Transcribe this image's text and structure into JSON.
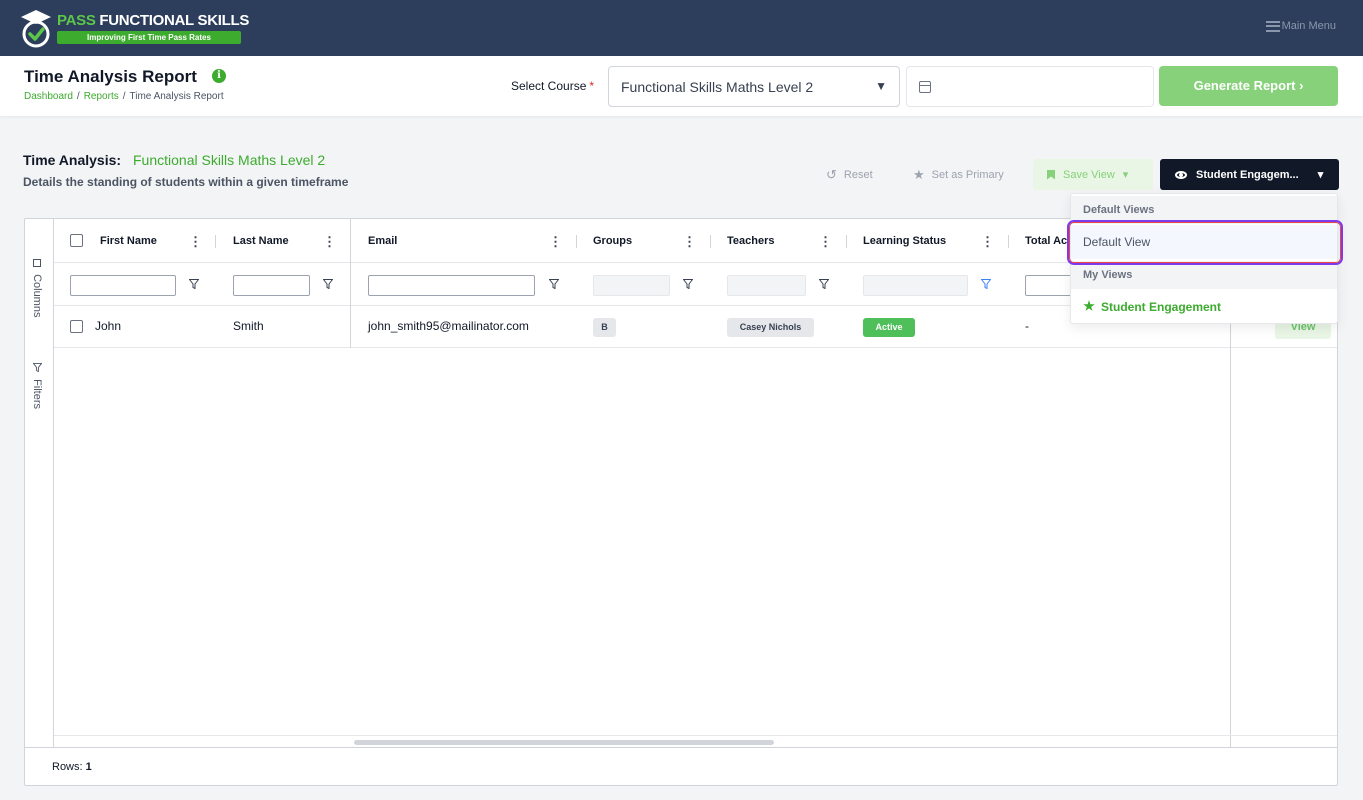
{
  "brand": {
    "title_accent": "PASS",
    "title_rest": " FUNCTIONAL SKILLS",
    "tagline": "Improving First Time Pass Rates"
  },
  "nav": {
    "main_menu": "Main Menu"
  },
  "header": {
    "title": "Time Analysis Report",
    "info_glyph": "i",
    "breadcrumb": [
      "Dashboard",
      "Reports",
      "Time Analysis Report"
    ],
    "breadcrumb_sep": "/",
    "select_label": "Select Course",
    "required_mark": "*",
    "course_value": "Functional Skills Maths Level 2",
    "caret": "▼",
    "date_value": "",
    "generate_label": "Generate Report ›"
  },
  "section": {
    "label": "Time Analysis:",
    "course": "Functional Skills Maths Level 2",
    "description": "Details the standing of students within a given timeframe"
  },
  "toolbar": {
    "reset": "Reset",
    "reset_glyph": "↺",
    "set_primary": "Set as Primary",
    "star_glyph": "★",
    "save_view": "Save View",
    "save_caret": "▾",
    "view_selector": "Student Engagem...",
    "view_caret": "▾"
  },
  "grid": {
    "side_tabs": {
      "columns": "Columns",
      "filters": "Filters"
    },
    "columns": [
      "First Name",
      "Last Name",
      "Email",
      "Groups",
      "Teachers",
      "Learning Status",
      "Total Ac"
    ],
    "menu_glyph": "⋮",
    "rows": [
      {
        "first_name": "John",
        "last_name": "Smith",
        "email": "john_smith95@mailinator.com",
        "group": "B",
        "teacher": "Casey Nichols",
        "status": "Active",
        "total": "-",
        "action": "View"
      }
    ],
    "footer_label": "Rows:",
    "footer_count": "1"
  },
  "dropdown": {
    "group_default": "Default Views",
    "default_view": "Default View",
    "group_mine": "My Views",
    "student_engagement": "Student Engagement"
  },
  "colors": {
    "nav_bg": "#2c3e5c",
    "brand_green": "#3cab2e",
    "button_green_light": "#86d17a",
    "dark_button": "#111827",
    "highlight_purple": "#7c3aed",
    "highlight_red": "#ef4444"
  }
}
